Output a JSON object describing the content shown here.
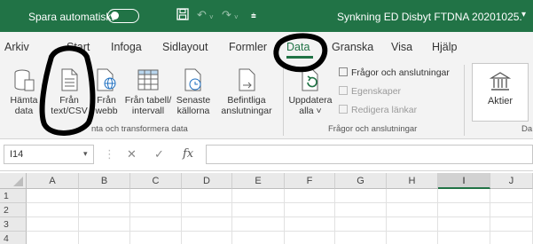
{
  "titlebar": {
    "autosave_label": "Spara automatiskt",
    "autosave_state": "off",
    "doc_title": "Synkning ED Disbyt FTDNA 20201025.",
    "doc_caret": "▾",
    "icons": [
      "save-icon",
      "undo-icon",
      "redo-icon",
      "customize-qat-icon"
    ]
  },
  "tabs": [
    "Arkiv",
    "Start",
    "Infoga",
    "Sidlayout",
    "Formler",
    "Data",
    "Granska",
    "Visa",
    "Hjälp"
  ],
  "active_tab": "Data",
  "ribbon": {
    "get_data": {
      "line1": "Hämta",
      "line2": "data"
    },
    "from_text": {
      "line1": "Från",
      "line2": "text/CSV"
    },
    "from_web": {
      "line1": "Från",
      "line2": "webb"
    },
    "from_table": {
      "line1": "Från tabell/",
      "line2": "intervall"
    },
    "recent_sources": {
      "line1": "Senaste",
      "line2": "källorna"
    },
    "existing_connections": {
      "line1": "Befintliga",
      "line2": "anslutningar"
    },
    "group_get_transform": "nta och transformera data",
    "refresh_all": {
      "line1": "Uppdatera",
      "line2": "alla ˅"
    },
    "queries_connections": "Frågor och anslutningar",
    "properties": "Egenskaper",
    "edit_links": "Redigera länkar",
    "group_queries": "Frågor och anslutningar",
    "stocks": "Aktier",
    "group_data_types": "Da"
  },
  "formula_bar": {
    "name_box": "I14",
    "cancel": "✕",
    "enter": "✓",
    "fx": "fx",
    "value": ""
  },
  "grid": {
    "columns": [
      "A",
      "B",
      "C",
      "D",
      "E",
      "F",
      "G",
      "H",
      "I",
      "J"
    ],
    "selected_column": "I",
    "rows": [
      "1",
      "2",
      "3",
      "4"
    ]
  },
  "colors": {
    "accent": "#217346",
    "annotation": "#000000"
  }
}
